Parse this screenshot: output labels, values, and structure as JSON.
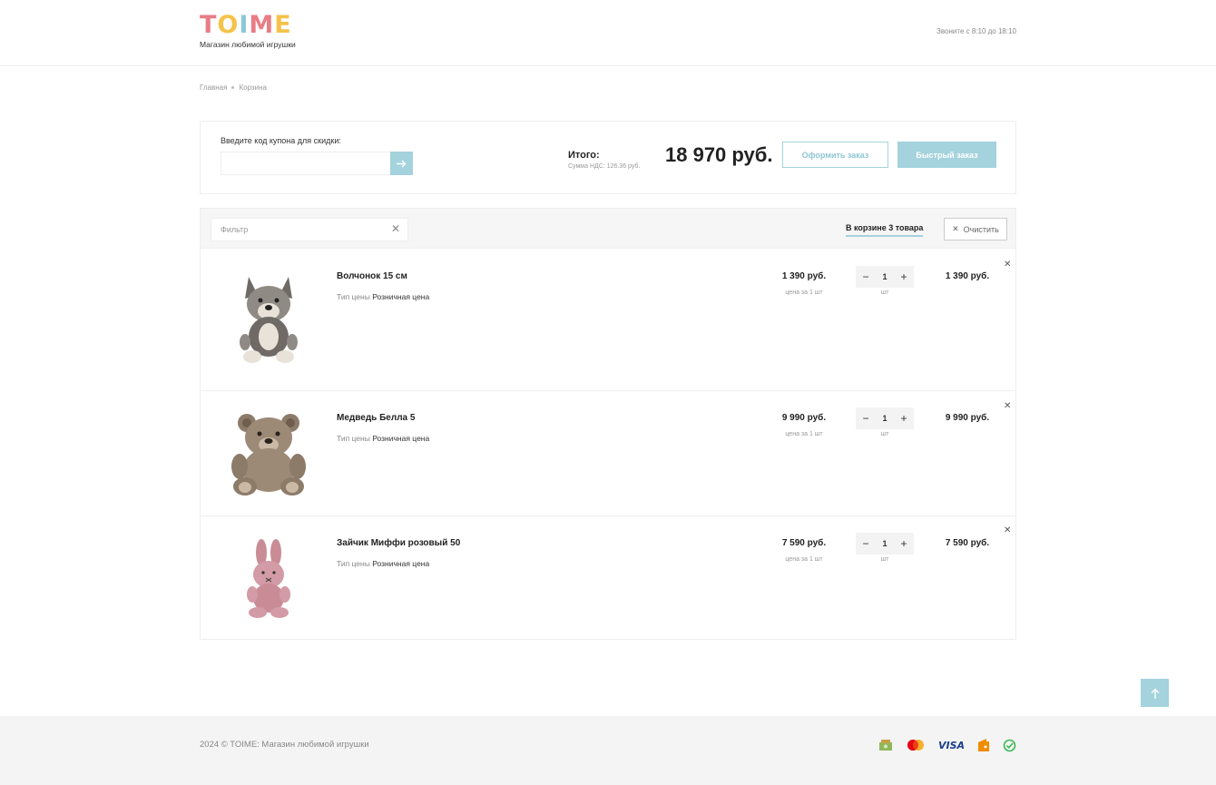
{
  "header": {
    "logo": {
      "letters": [
        "T",
        "O",
        "I",
        "M",
        "E"
      ],
      "colors": [
        "#e87d86",
        "#f5c24a",
        "#8cc7d6",
        "#e87d86",
        "#f5c24a"
      ]
    },
    "tagline": "Магазин любимой игрушки",
    "phone_note": "Звоните с 8:10 до 18:10"
  },
  "breadcrumb": {
    "home": "Главная",
    "current": "Корзина"
  },
  "summary": {
    "coupon_label": "Введите код купона для скидки:",
    "coupon_value": "",
    "total_label": "Итого:",
    "vat_note": "Сумма НДС: 126.36 руб.",
    "total_amount": "18 970 руб.",
    "checkout_label": "Оформить заказ",
    "quick_order_label": "Быстрый заказ"
  },
  "cart": {
    "filter_placeholder": "Фильтр",
    "count_label": "В корзине 3 товара",
    "clear_label": "Очистить",
    "items": [
      {
        "name": "Волчонок 15 см",
        "price_type_label": "Тип цены",
        "price_type_value": "Розничная цена",
        "unit_price": "1 390 руб.",
        "unit_note": "цена за 1 шт",
        "quantity": "1",
        "qty_unit": "шт",
        "line_total": "1 390 руб.",
        "icon": "wolf-plush"
      },
      {
        "name": "Медведь Белла 5",
        "price_type_label": "Тип цены",
        "price_type_value": "Розничная цена",
        "unit_price": "9 990 руб.",
        "unit_note": "цена за 1 шт",
        "quantity": "1",
        "qty_unit": "шт",
        "line_total": "9 990 руб.",
        "icon": "bear-plush"
      },
      {
        "name": "Зайчик Миффи розовый 50",
        "price_type_label": "Тип цены",
        "price_type_value": "Розничная цена",
        "unit_price": "7 590 руб.",
        "unit_note": "цена за 1 шт",
        "quantity": "1",
        "qty_unit": "шт",
        "line_total": "7 590 руб.",
        "icon": "bunny-plush"
      }
    ]
  },
  "footer": {
    "copyright": "2024 © TOIME: Магазин любимой игрушки",
    "payment_icons": [
      "cash-icon",
      "mastercard-icon",
      "visa-icon",
      "yandex-money-icon",
      "sbp-icon"
    ],
    "visa_label": "VISA"
  },
  "colors": {
    "accent": "#a4d2dd",
    "text": "#222222",
    "muted": "#999999"
  }
}
